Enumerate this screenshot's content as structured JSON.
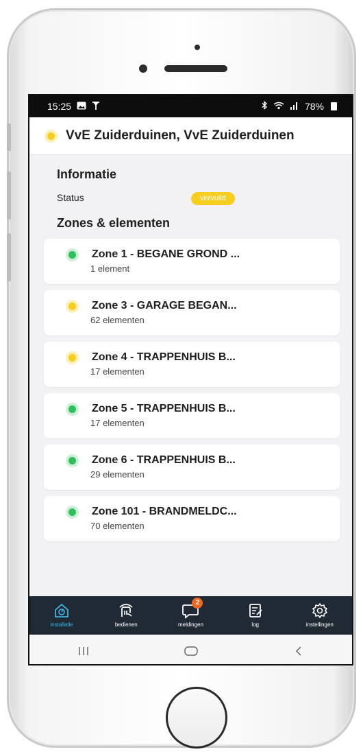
{
  "statusbar": {
    "time": "15:25",
    "left_icons": [
      "gallery-icon",
      "antenna-icon"
    ],
    "right_icons": [
      "bluetooth-icon",
      "wifi-icon",
      "signal-icon"
    ],
    "battery": "78%"
  },
  "header": {
    "status_color": "#f7cd1f",
    "title": "VvE Zuiderduinen, VvE Zuiderduinen"
  },
  "info": {
    "heading": "Informatie",
    "status_label": "Status",
    "status_badge": "vervuild",
    "badge_color": "#f7cd1f"
  },
  "zones": {
    "heading": "Zones & elementen",
    "items": [
      {
        "name": "Zone 1 - BEGANE GROND ...",
        "count": "1 element",
        "status": "green"
      },
      {
        "name": "Zone 3 - GARAGE BEGAN...",
        "count": "62 elementen",
        "status": "yellow"
      },
      {
        "name": "Zone 4 - TRAPPENHUIS B...",
        "count": "17 elementen",
        "status": "yellow"
      },
      {
        "name": "Zone 5 - TRAPPENHUIS B...",
        "count": "17 elementen",
        "status": "green"
      },
      {
        "name": "Zone 6 - TRAPPENHUIS B...",
        "count": "29 elementen",
        "status": "green"
      },
      {
        "name": "Zone 101 - BRANDMELDC...",
        "count": "70 elementen",
        "status": "green"
      }
    ]
  },
  "bottom_nav": {
    "items": [
      {
        "label": "installatie",
        "icon": "installation-icon",
        "active": true
      },
      {
        "label": "bedienen",
        "icon": "remote-control-icon",
        "active": false
      },
      {
        "label": "meldingen",
        "icon": "chat-bubble-icon",
        "active": false,
        "badge": "2"
      },
      {
        "label": "log",
        "icon": "log-icon",
        "active": false
      },
      {
        "label": "instellingen",
        "icon": "gear-icon",
        "active": false
      }
    ],
    "active_color": "#3fb4e8",
    "background": "#1f2a35"
  },
  "system_nav": {
    "icons": [
      "recent-apps-icon",
      "home-icon",
      "back-icon"
    ]
  }
}
